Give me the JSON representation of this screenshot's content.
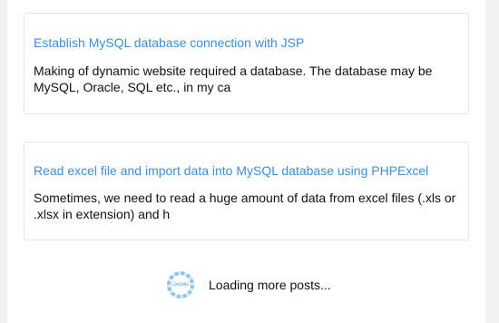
{
  "posts": [
    {
      "title": "Establish MySQL database connection with JSP",
      "excerpt": "Making of dynamic website required a database. The database may be MySQL, Oracle, SQL etc., in my ca"
    },
    {
      "title": "Read excel file and import data into MySQL database using PHPExcel",
      "excerpt": "Sometimes, we need to read a huge amount of data from excel files (.xls or .xlsx in extension) and h"
    }
  ],
  "loader": {
    "spinner_label": "LOADING",
    "text": "Loading more posts...",
    "accent_color": "#3a8fd6",
    "icon": "spinner-icon"
  }
}
